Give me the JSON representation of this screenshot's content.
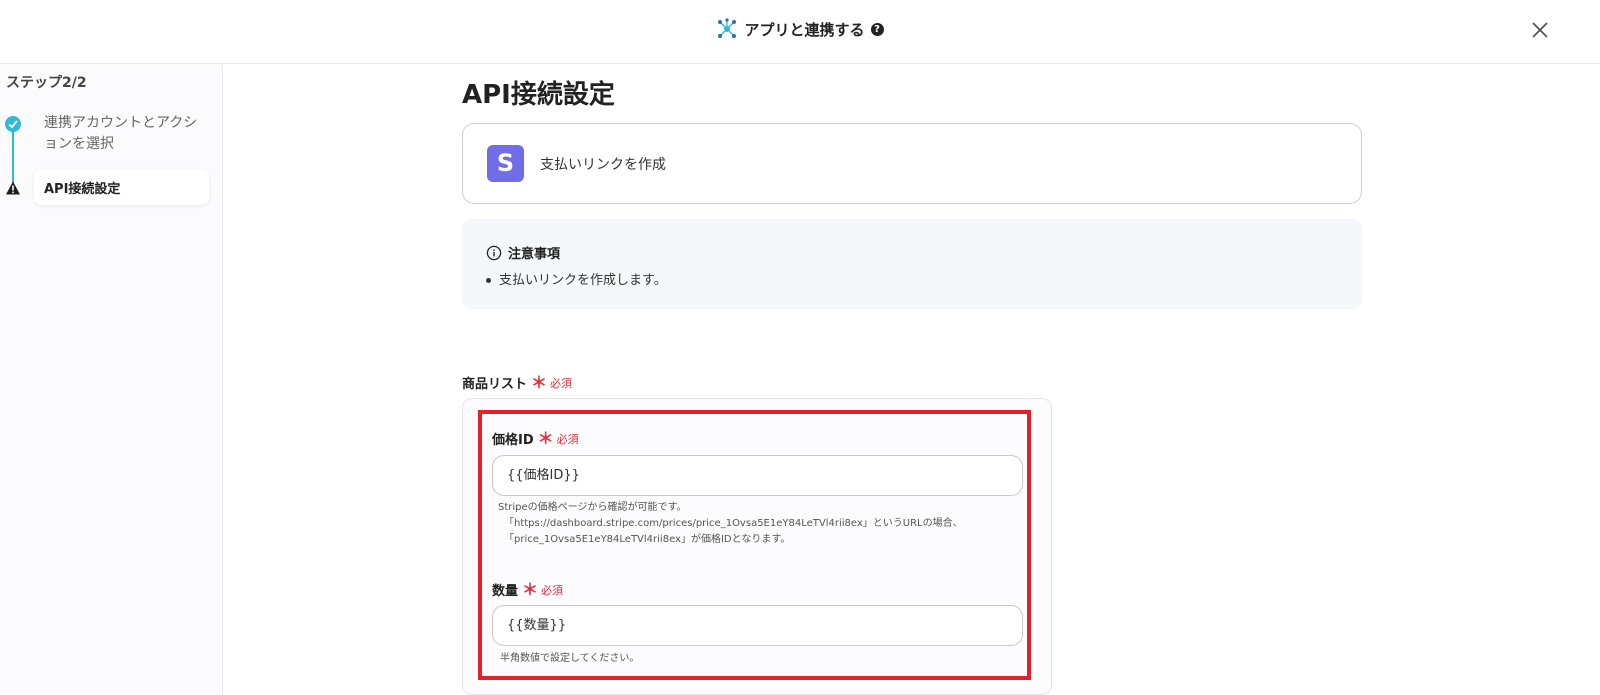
{
  "header": {
    "title": "アプリと連携する",
    "help_glyph": "?",
    "icons": [
      "network-icon",
      "help-icon",
      "close-icon"
    ]
  },
  "sidebar": {
    "step_label": "ステップ2/2",
    "steps": [
      {
        "label": "連携アカウントとアクションを選択",
        "status": "completed",
        "icon": "check-icon"
      },
      {
        "label": "API接続設定",
        "status": "warning",
        "icon": "warning-icon"
      }
    ]
  },
  "main": {
    "title": "API接続設定",
    "action": {
      "logo_letter": "S",
      "label": "支払いリンクを作成",
      "logo_color": "#6f6ee8"
    },
    "notice": {
      "title": "注意事項",
      "items": [
        "支払いリンクを作成します。"
      ]
    },
    "product_list": {
      "label": "商品リスト",
      "required_star": "＊",
      "required_text": "必須",
      "fields": [
        {
          "label": "価格ID",
          "required_star": "＊",
          "required_text": "必須",
          "value": "{{価格ID}}",
          "help": [
            "Stripeの価格ページから確認が可能です。",
            "「https://dashboard.stripe.com/prices/price_1Ovsa5E1eY84LeTVl4rii8ex」というURLの場合、",
            "「price_1Ovsa5E1eY84LeTVl4rii8ex」が価格IDとなります。"
          ]
        },
        {
          "label": "数量",
          "required_star": "＊",
          "required_text": "必須",
          "value": "{{数量}}",
          "help": [
            "半角数値で設定してください。"
          ]
        }
      ]
    }
  },
  "colors": {
    "accent": "#2fb9d4",
    "required": "#e0303c",
    "highlight": "#e32128"
  }
}
